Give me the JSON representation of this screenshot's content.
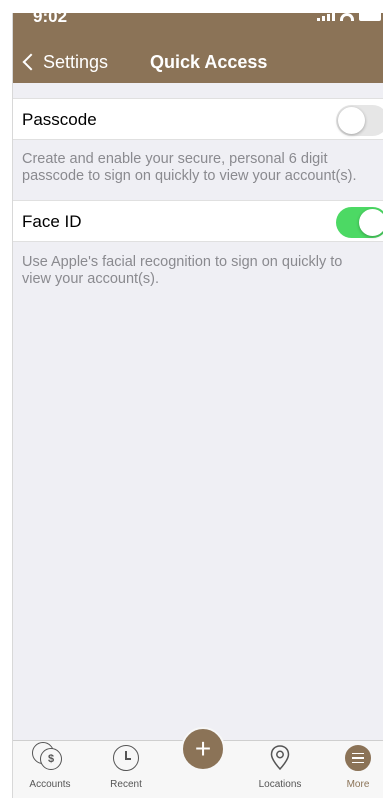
{
  "status_bar": {
    "time": "9:02"
  },
  "nav": {
    "back_label": "Settings",
    "title": "Quick Access"
  },
  "settings": [
    {
      "label": "Passcode",
      "enabled": false,
      "description": "Create and enable your secure, personal 6 digit passcode to sign on quickly to view your account(s)."
    },
    {
      "label": "Face ID",
      "enabled": true,
      "description": "Use Apple's facial recognition to sign on quickly to view your account(s)."
    }
  ],
  "tabs": {
    "accounts": {
      "label": "Accounts",
      "icon": "coins-icon",
      "glyph": "$"
    },
    "recent": {
      "label": "Recent",
      "icon": "clock-icon"
    },
    "add": {
      "icon": "plus-icon",
      "glyph": "+"
    },
    "locations": {
      "label": "Locations",
      "icon": "location-pin-icon"
    },
    "more": {
      "label": "More",
      "icon": "menu-icon",
      "active": true
    }
  },
  "colors": {
    "brand": "#8b7357",
    "toggle_on": "#4cd964",
    "toggle_off": "#e6e6e6",
    "description_text": "#8a8a8f",
    "background": "#efeff4"
  }
}
